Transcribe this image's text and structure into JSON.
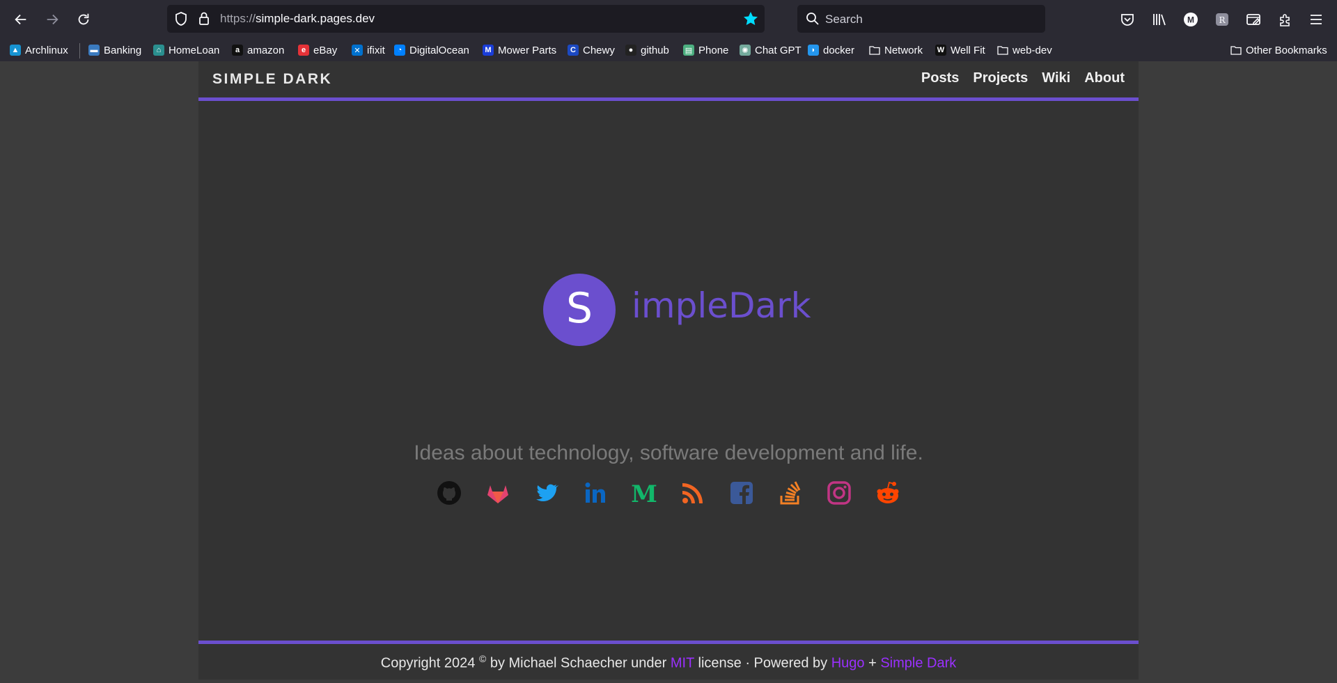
{
  "browser": {
    "url_scheme": "https://",
    "url_host": "simple-dark.pages.dev",
    "search_placeholder": "Search",
    "bookmarks": [
      {
        "label": "Archlinux",
        "icon": "archlinux-icon",
        "color": "#1793d1",
        "glyph": "▲"
      },
      {
        "label": "Banking",
        "icon": "banking-icon",
        "color": "#3a7abf",
        "glyph": "▬"
      },
      {
        "label": "HomeLoan",
        "icon": "homeloan-icon",
        "color": "#2a8f8f",
        "glyph": "⌂"
      },
      {
        "label": "amazon",
        "icon": "amazon-icon",
        "color": "#111111",
        "glyph": "a"
      },
      {
        "label": "eBay",
        "icon": "ebay-icon",
        "color": "#e53238",
        "glyph": "e"
      },
      {
        "label": "ifixit",
        "icon": "ifixit-icon",
        "color": "#0071ce",
        "glyph": "✕"
      },
      {
        "label": "DigitalOcean",
        "icon": "digitalocean-icon",
        "color": "#0080ff",
        "glyph": "◔"
      },
      {
        "label": "Mower Parts",
        "icon": "mowerparts-icon",
        "color": "#1a3dd8",
        "glyph": "M"
      },
      {
        "label": "Chewy",
        "icon": "chewy-icon",
        "color": "#1c49c2",
        "glyph": "C"
      },
      {
        "label": "github",
        "icon": "github-icon",
        "color": "#222222",
        "glyph": "●"
      },
      {
        "label": "Phone",
        "icon": "phone-icon",
        "color": "#4caf80",
        "glyph": "▤"
      },
      {
        "label": "Chat GPT",
        "icon": "chatgpt-icon",
        "color": "#74aa9c",
        "glyph": "✺"
      },
      {
        "label": "docker",
        "icon": "docker-icon",
        "color": "#2496ed",
        "glyph": "◗"
      },
      {
        "label": "Network",
        "icon": "folder-icon",
        "color": "transparent",
        "glyph": ""
      },
      {
        "label": "Well Fit",
        "icon": "wellfit-icon",
        "color": "#111111",
        "glyph": "W"
      },
      {
        "label": "web-dev",
        "icon": "folder-icon",
        "color": "transparent",
        "glyph": ""
      }
    ],
    "other_bookmarks": "Other Bookmarks"
  },
  "site": {
    "title": "SIMPLE DARK",
    "nav": [
      "Posts",
      "Projects",
      "Wiki",
      "About"
    ],
    "logo_letter": "S",
    "logo_rest": "impleDark",
    "tagline": "Ideas about technology, software development and life.",
    "socials": [
      {
        "name": "github",
        "color": "#111111"
      },
      {
        "name": "gitlab",
        "color": "#e24370"
      },
      {
        "name": "twitter",
        "color": "#1da1f2"
      },
      {
        "name": "linkedin",
        "color": "#0a66c2"
      },
      {
        "name": "medium",
        "color": "#12b76a"
      },
      {
        "name": "rss",
        "color": "#f26522"
      },
      {
        "name": "facebook",
        "color": "#3b5998"
      },
      {
        "name": "stackoverflow",
        "color": "#f48024"
      },
      {
        "name": "instagram",
        "color": "#c13584"
      },
      {
        "name": "reddit",
        "color": "#ff4500"
      }
    ],
    "footer": {
      "prefix": "Copyright 2024 ",
      "copyright_mark": "©",
      "by": " by Michael Schaecher under ",
      "license_link": "MIT",
      "license_suffix": " license · Powered by ",
      "hugo_link": "Hugo",
      "plus": " + ",
      "theme_link": "Simple Dark"
    },
    "accent_color": "#6b4fce"
  }
}
